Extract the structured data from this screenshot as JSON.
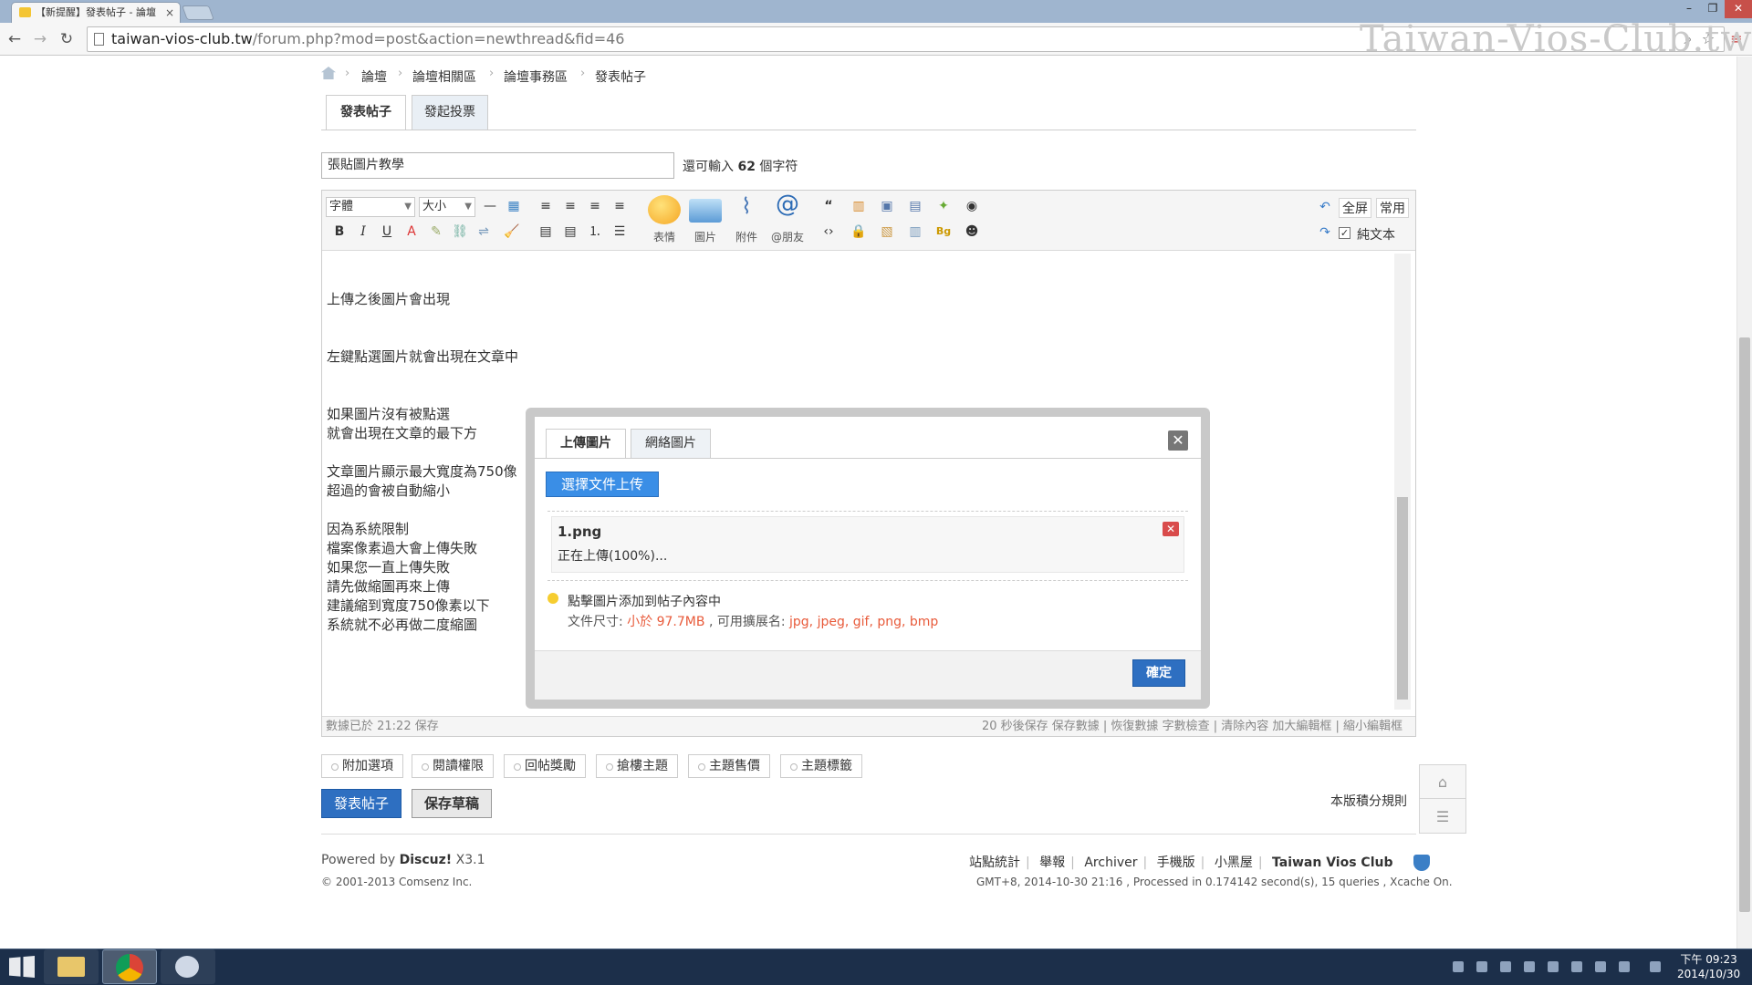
{
  "browser": {
    "tab_title": "【新提醒】發表帖子 - 論壇",
    "url_host": "taiwan-vios-club.tw",
    "url_path": "/forum.php?mod=post&action=newthread&fid=46",
    "watermark": "Taiwan-Vios-Club.tw"
  },
  "breadcrumb": {
    "items": [
      "論壇",
      "論壇相關區",
      "論壇事務區",
      "發表帖子"
    ]
  },
  "post_tabs": [
    "發表帖子",
    "發起投票"
  ],
  "subject": {
    "value": "張貼圖片教學",
    "remaining_prefix": "還可輸入",
    "remaining_count": "62",
    "remaining_suffix": "個字符"
  },
  "editor": {
    "font_select": "字體",
    "size_select": "大小",
    "big_buttons": [
      "表情",
      "圖片",
      "附件",
      "@朋友"
    ],
    "right_buttons": {
      "fullscreen": "全屏",
      "common": "常用",
      "plain": "純文本"
    },
    "lines": [
      "上傳之後圖片會出現",
      "",
      "",
      "左鍵點選圖片就會出現在文章中",
      "",
      "",
      "如果圖片沒有被點選",
      "就會出現在文章的最下方",
      "",
      "文章圖片顯示最大寬度為750像",
      "超過的會被自動縮小",
      "",
      "因為系統限制",
      "檔案像素過大會上傳失敗",
      "如果您一直上傳失敗",
      "請先做縮圖再來上傳",
      "建議縮到寬度750像素以下",
      "系統就不必再做二度縮圖"
    ],
    "status_left": "數據已於 21:22 保存",
    "status_right": "20 秒後保存 保存數據 | 恢復數據    字數檢查 | 清除內容    加大編輯框 | 縮小編輯框"
  },
  "options": [
    "附加選項",
    "閱讀權限",
    "回帖獎勵",
    "搶樓主題",
    "主題售價",
    "主題標籤"
  ],
  "actions": {
    "submit": "發表帖子",
    "draft": "保存草稿",
    "rules": "本版積分規則"
  },
  "footer": {
    "powered_prefix": "Powered by",
    "powered_brand": "Discuz!",
    "powered_version": "X3.1",
    "copyright": "© 2001-2013 Comsenz Inc.",
    "links": [
      "站點統計",
      "舉報",
      "Archiver",
      "手機版",
      "小黑屋",
      "Taiwan Vios Club"
    ],
    "gmt": "GMT+8, 2014-10-30 21:16 , Processed in 0.174142 second(s), 15 queries , Xcache On."
  },
  "dialog": {
    "tabs": [
      "上傳圖片",
      "網絡圖片"
    ],
    "choose_button": "選擇文件上传",
    "file_name": "1.png",
    "file_status": "正在上傳(100%)...",
    "tip": "點擊圖片添加到帖子內容中",
    "size_label": "文件尺寸:",
    "size_value": "小於 97.7MB",
    "ext_label": ", 可用擴展名:",
    "ext_value": "jpg, jpeg, gif, png, bmp",
    "confirm": "確定"
  },
  "taskbar": {
    "time": "下午 09:23",
    "date": "2014/10/30"
  }
}
